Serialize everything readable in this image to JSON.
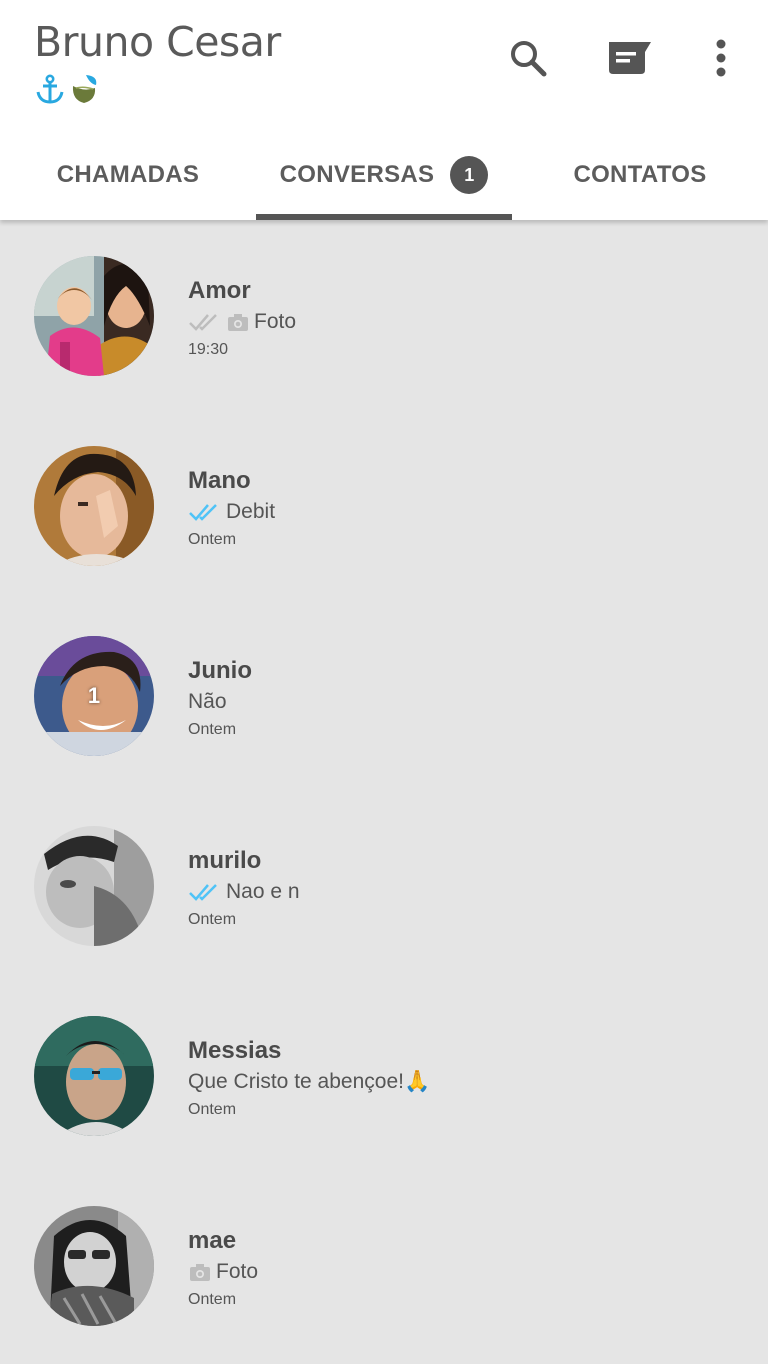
{
  "header": {
    "title": "Bruno Cesar",
    "status_icons": [
      "anchor-icon",
      "teacup-leaf-icon"
    ],
    "actions": [
      "search-icon",
      "new-chat-icon",
      "more-vert-icon"
    ]
  },
  "tabs": [
    {
      "label": "CHAMADAS",
      "active": false
    },
    {
      "label": "CONVERSAS",
      "active": true,
      "badge": "1"
    },
    {
      "label": "CONTATOS",
      "active": false
    }
  ],
  "colors": {
    "read_tick": "#4fc3f7",
    "delivered_tick": "#bdbdbd",
    "list_bg": "#e5e5e5",
    "header_bg": "#ffffff",
    "tab_indicator": "#555555"
  },
  "chats": [
    {
      "name": "Amor",
      "preview_icons": [
        "double-check-gray-icon",
        "camera-icon"
      ],
      "preview": "Foto",
      "time": "19:30",
      "unread": ""
    },
    {
      "name": "Mano",
      "preview_icons": [
        "double-check-blue-icon"
      ],
      "preview": "Debit",
      "time": "Ontem",
      "unread": ""
    },
    {
      "name": "Junio",
      "preview_icons": [],
      "preview": "Não",
      "time": "Ontem",
      "unread": "1"
    },
    {
      "name": "murilo",
      "preview_icons": [
        "double-check-blue-icon"
      ],
      "preview": "Nao e n",
      "time": "Ontem",
      "unread": ""
    },
    {
      "name": "Messias",
      "preview_icons": [],
      "preview": "Que Cristo te abençoe!🙏",
      "time": "Ontem",
      "unread": ""
    },
    {
      "name": "mae",
      "preview_icons": [
        "camera-icon"
      ],
      "preview": "Foto",
      "time": "Ontem",
      "unread": ""
    }
  ]
}
